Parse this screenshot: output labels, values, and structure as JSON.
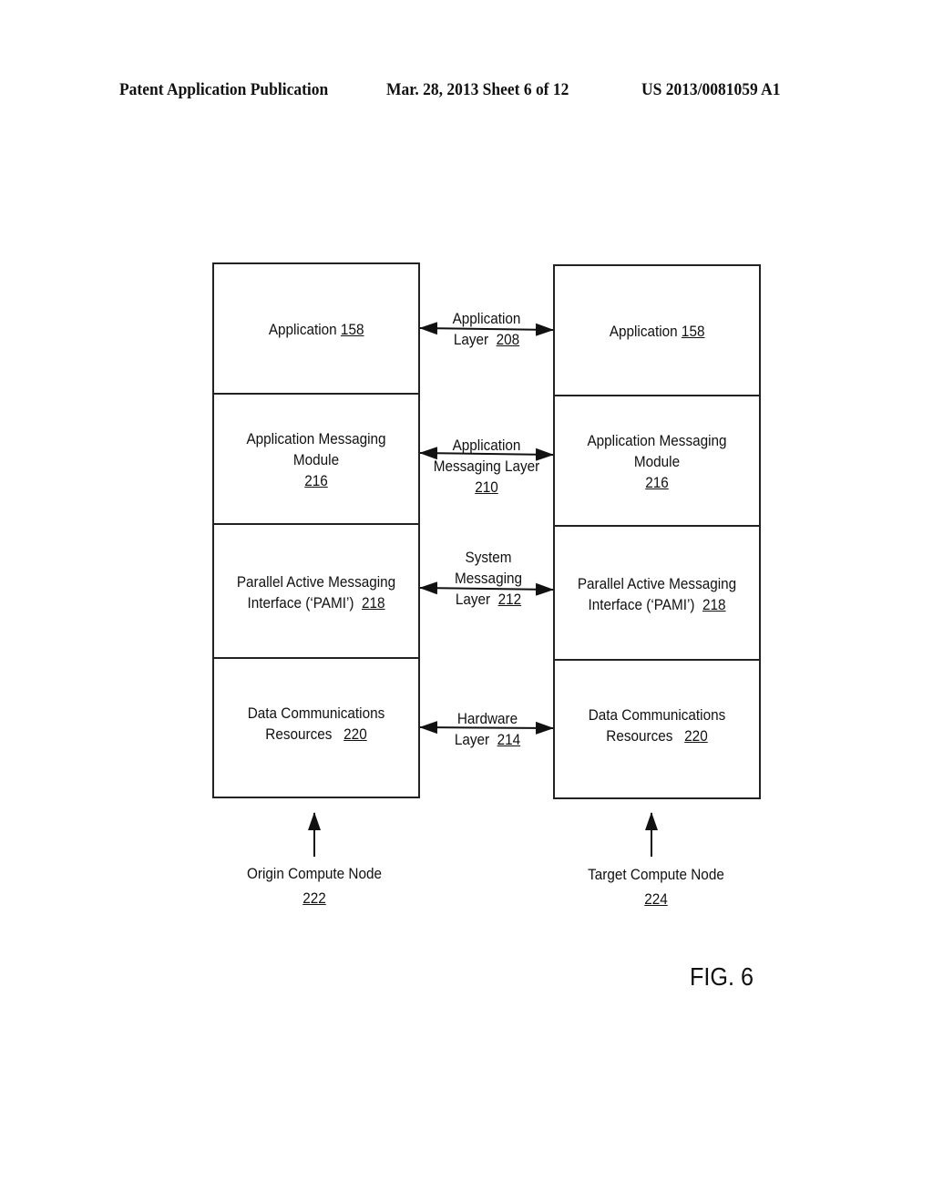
{
  "header": {
    "publication": "Patent Application Publication",
    "date_sheet": "Mar. 28, 2013  Sheet 6 of 12",
    "pub_number": "US 2013/0081059 A1"
  },
  "origin_stack": {
    "cells": [
      {
        "text": "Application",
        "ref": "158"
      },
      {
        "text": "Application Messaging Module",
        "ref": "216"
      },
      {
        "text": "Parallel Active Messaging Interface (‘PAMI’)",
        "ref": "218"
      },
      {
        "text": "Data Communications Resources",
        "ref": "220"
      }
    ],
    "node_label": "Origin Compute Node",
    "node_ref": "222"
  },
  "target_stack": {
    "cells": [
      {
        "text": "Application",
        "ref": "158"
      },
      {
        "text": "Application Messaging Module",
        "ref": "216"
      },
      {
        "text": "Parallel Active Messaging Interface (‘PAMI’)",
        "ref": "218"
      },
      {
        "text": "Data Communications Resources",
        "ref": "220"
      }
    ],
    "node_label": "Target Compute Node",
    "node_ref": "224"
  },
  "layers": [
    {
      "line1": "Application",
      "line2": "Layer",
      "ref": "208"
    },
    {
      "line1": "Application",
      "line2": "Messaging Layer",
      "ref": "210"
    },
    {
      "line1": "System",
      "line2": "Messaging",
      "line3": "Layer",
      "ref": "212"
    },
    {
      "line1": "Hardware",
      "line2": "Layer",
      "ref": "214"
    }
  ],
  "figure_label": "FIG. 6"
}
